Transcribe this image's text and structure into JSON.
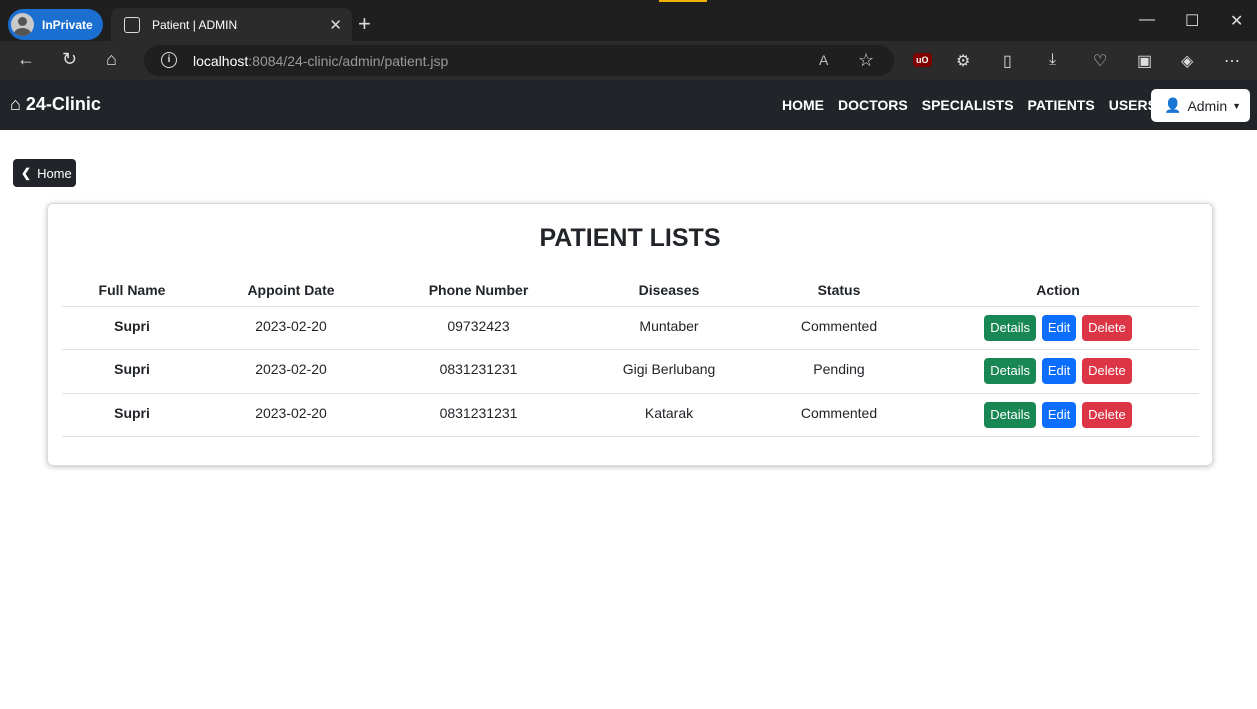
{
  "browser": {
    "inprivate_label": "InPrivate",
    "tab_title": "Patient | ADMIN",
    "url_host": "localhost",
    "url_path": ":8084/24-clinic/admin/patient.jsp",
    "read_aloud": "A"
  },
  "navbar": {
    "brand": "24-Clinic",
    "links": [
      "HOME",
      "DOCTORS",
      "SPECIALISTS",
      "PATIENTS",
      "USERS"
    ],
    "admin_label": "Admin"
  },
  "home_button": "Home",
  "page_title": "PATIENT LISTS",
  "table": {
    "headers": [
      "Full Name",
      "Appoint Date",
      "Phone Number",
      "Diseases",
      "Status",
      "Action"
    ],
    "rows": [
      {
        "name": "Supri",
        "date": "2023-02-20",
        "phone": "09732423",
        "disease": "Muntaber",
        "status": "Commented"
      },
      {
        "name": "Supri",
        "date": "2023-02-20",
        "phone": "0831231231",
        "disease": "Gigi Berlubang",
        "status": "Pending"
      },
      {
        "name": "Supri",
        "date": "2023-02-20",
        "phone": "0831231231",
        "disease": "Katarak",
        "status": "Commented"
      }
    ],
    "action_labels": {
      "details": "Details",
      "edit": "Edit",
      "delete": "Delete"
    }
  },
  "colors": {
    "navbar": "#212529",
    "details": "#198754",
    "edit": "#0d6efd",
    "delete": "#dc3545"
  }
}
